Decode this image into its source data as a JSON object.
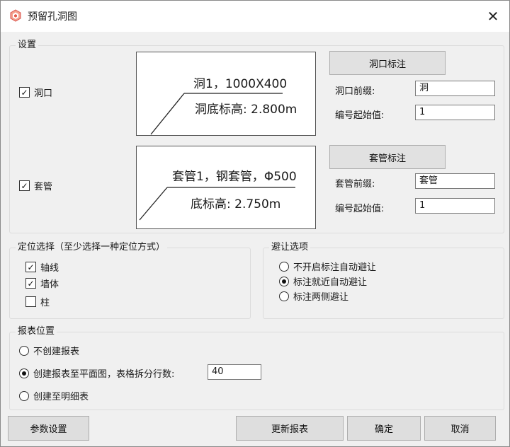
{
  "window": {
    "title": "预留孔洞图",
    "app_icon": "app-logo-icon",
    "close_glyph": "✕"
  },
  "settings": {
    "legend": "设置",
    "hole": {
      "label": "洞口",
      "checked": true,
      "preview_line1": "洞1，1000X400",
      "preview_line2": "洞底标高: 2.800m",
      "annotate_button": "洞口标注",
      "prefix_label": "洞口前缀:",
      "prefix_value": "洞",
      "start_label": "编号起始值:",
      "start_value": "1"
    },
    "sleeve": {
      "label": "套管",
      "checked": true,
      "preview_line1": "套管1，钢套管，Φ500",
      "preview_line2": "底标高: 2.750m",
      "annotate_button": "套管标注",
      "prefix_label": "套管前缀:",
      "prefix_value": "套管",
      "start_label": "编号起始值:",
      "start_value": "1"
    }
  },
  "positioning": {
    "legend": "定位选择（至少选择一种定位方式）",
    "options": [
      {
        "label": "轴线",
        "checked": true
      },
      {
        "label": "墙体",
        "checked": true
      },
      {
        "label": "柱",
        "checked": false
      }
    ]
  },
  "avoidance": {
    "legend": "避让选项",
    "options": [
      {
        "label": "不开启标注自动避让",
        "selected": false
      },
      {
        "label": "标注就近自动避让",
        "selected": true
      },
      {
        "label": "标注两侧避让",
        "selected": false
      }
    ]
  },
  "report": {
    "legend": "报表位置",
    "options": [
      {
        "label": "不创建报表",
        "selected": false
      },
      {
        "label": "创建报表至平面图，表格拆分行数:",
        "selected": true
      },
      {
        "label": "创建至明细表",
        "selected": false
      }
    ],
    "rows_value": "40"
  },
  "footer": {
    "params_button": "参数设置",
    "update_button": "更新报表",
    "ok_button": "确定",
    "cancel_button": "取消"
  }
}
